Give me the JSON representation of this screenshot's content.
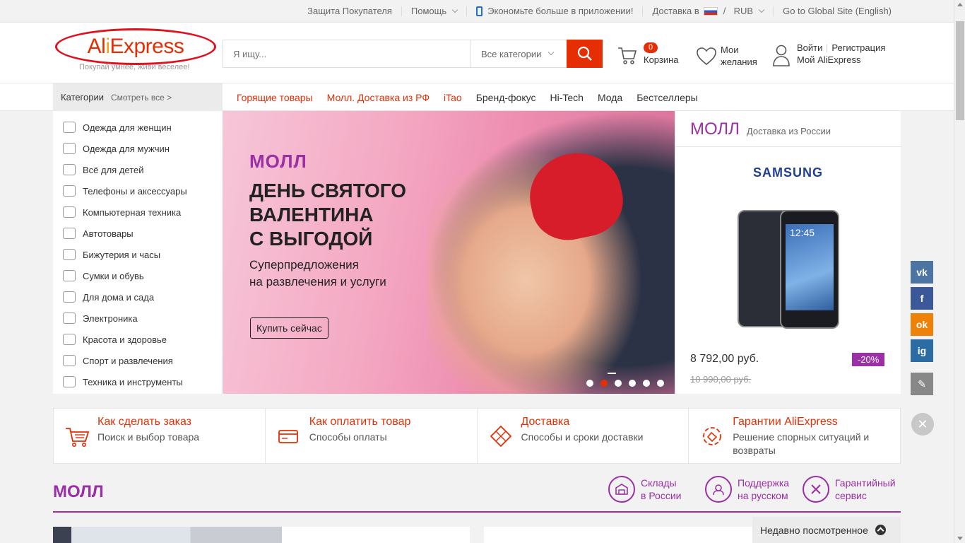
{
  "topbar": {
    "buyer_protection": "Защита Покупателя",
    "help": "Помощь",
    "app": "Экономьте больше в приложении!",
    "delivery": "Доставка в",
    "currency": "RUB",
    "global": "Go to Global Site (English)"
  },
  "header": {
    "logo": "AliExpress",
    "tagline": "Покупай умнее, живи веселее!",
    "search_placeholder": "Я ищу...",
    "category_select": "Все категории",
    "cart_count": "0",
    "cart_label": "Корзина",
    "wishlist_label": "Мои желания",
    "login": "Войти",
    "register": "Регистрация",
    "my_account": "Мой AliExpress"
  },
  "nav": {
    "categories": "Категории",
    "see_all": "Смотреть все >",
    "links": [
      "Горящие товары",
      "Молл. Доставка из РФ",
      "iTao",
      "Бренд-фокус",
      "Hi-Tech",
      "Мода",
      "Бестселлеры"
    ]
  },
  "sidebar": {
    "items": [
      "Одежда для женщин",
      "Одежда для мужчин",
      "Всё для детей",
      "Телефоны и аксессуары",
      "Компьютерная техника",
      "Автотовары",
      "Бижутерия и часы",
      "Сумки и обувь",
      "Для дома и сада",
      "Электроника",
      "Красота и здоровье",
      "Спорт и развлечения",
      "Техника и инструменты"
    ]
  },
  "banner": {
    "mall": "МОЛЛ",
    "title_lines": [
      "ДЕНЬ СВЯТОГО",
      "ВАЛЕНТИНА",
      "С ВЫГОДОЙ"
    ],
    "sub_lines": [
      "Суперпредложения",
      "на развлечения и услуги"
    ],
    "cta": "Купить сейчас",
    "slides": 6,
    "active_slide": 2
  },
  "mallbox": {
    "title": "МОЛЛ",
    "subtitle": "Доставка из России",
    "brand": "SAMSUNG",
    "phone_time": "12:45",
    "price": "8 792,00 руб.",
    "old_price": "10 990,00 руб.",
    "discount": "-20%"
  },
  "info": [
    {
      "title": "Как сделать заказ",
      "sub": "Поиск и выбор товара",
      "icon": "cart-icon"
    },
    {
      "title": "Как оплатить товар",
      "sub": "Способы оплаты",
      "icon": "card-icon"
    },
    {
      "title": "Доставка",
      "sub": "Способы и сроки доставки",
      "icon": "box-icon"
    },
    {
      "title": "Гарантии AliExpress",
      "sub": "Решение спорных ситуаций и возвраты",
      "icon": "guarantee-icon"
    }
  ],
  "mall_section": {
    "title": "МОЛЛ",
    "features": [
      {
        "l1": "Склады",
        "l2": "в России"
      },
      {
        "l1": "Поддержка",
        "l2": "на русском"
      },
      {
        "l1": "Гарантийный",
        "l2": "сервис"
      }
    ]
  },
  "recent": {
    "label": "Недавно посмотренное"
  },
  "social": [
    {
      "name": "vk-icon",
      "label": "vk",
      "color": "#4c75a3"
    },
    {
      "name": "facebook-icon",
      "label": "f",
      "color": "#3b5998"
    },
    {
      "name": "odnoklassniki-icon",
      "label": "ok",
      "color": "#ee8208"
    },
    {
      "name": "instagram-icon",
      "label": "ig",
      "color": "#2b6ca3"
    },
    {
      "name": "edit-icon",
      "label": "✎",
      "color": "#888888"
    }
  ],
  "colors": {
    "accent": "#e62e04",
    "mall": "#9b2fa6"
  }
}
